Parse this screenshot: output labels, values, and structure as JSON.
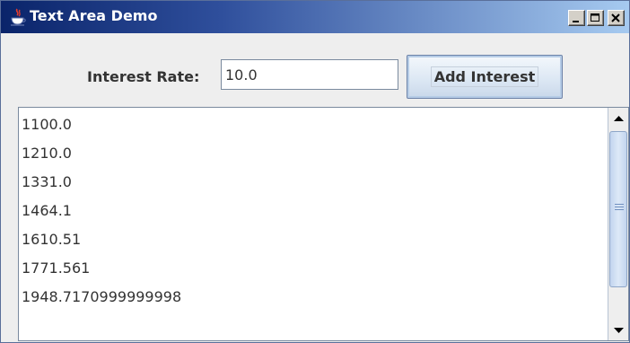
{
  "window": {
    "title": "Text Area Demo"
  },
  "form": {
    "rate_label": "Interest Rate:",
    "rate_value": "10.0",
    "add_button_label": "Add Interest"
  },
  "output": {
    "lines": [
      "1100.0",
      "1210.0",
      "1331.0",
      "1464.1",
      "1610.51",
      "1771.561",
      "1948.7170999999998"
    ]
  },
  "icons": {
    "app": "java-cup-icon",
    "minimize": "minimize-icon",
    "maximize": "maximize-icon",
    "close": "close-icon",
    "scroll_up": "arrow-up-icon",
    "scroll_down": "arrow-down-icon"
  },
  "colors": {
    "titlebar_start": "#0a246a",
    "titlebar_end": "#a6caf0",
    "button_face": "#dde8f4",
    "window_bg": "#eeeeee"
  }
}
